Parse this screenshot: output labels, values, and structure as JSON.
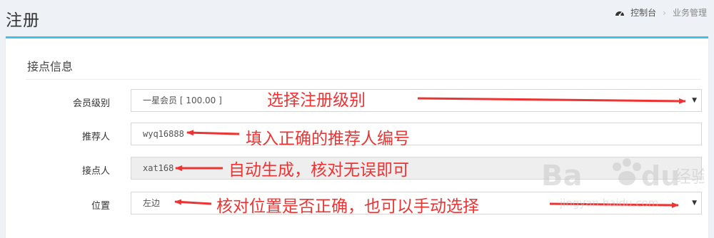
{
  "header": {
    "title": "注册",
    "breadcrumb": {
      "dashboard": "控制台",
      "current": "业务管理"
    }
  },
  "card": {
    "title": "接点信息",
    "fields": {
      "level": {
        "label": "会员级别",
        "value": "一星会员 [ 100.00 ]"
      },
      "referrer": {
        "label": "推荐人",
        "value": "wyq16888"
      },
      "contact": {
        "label": "接点人",
        "value": "xat168"
      },
      "position": {
        "label": "位置",
        "value": "左边"
      }
    }
  },
  "annotations": {
    "level": "选择注册级别",
    "referrer": "填入正确的推荐人编号",
    "contact": "自动生成，核对无误即可",
    "position": "核对位置是否正确，也可以手动选择"
  },
  "watermark": {
    "brand_text": "Bai du 经验",
    "url": "jingyan.baidu.com"
  },
  "colors": {
    "accent": "#3cc3e6",
    "annotation": "#ee3333"
  },
  "icons": {
    "dashboard": "dashboard-icon",
    "caret": "caret-down-icon"
  }
}
